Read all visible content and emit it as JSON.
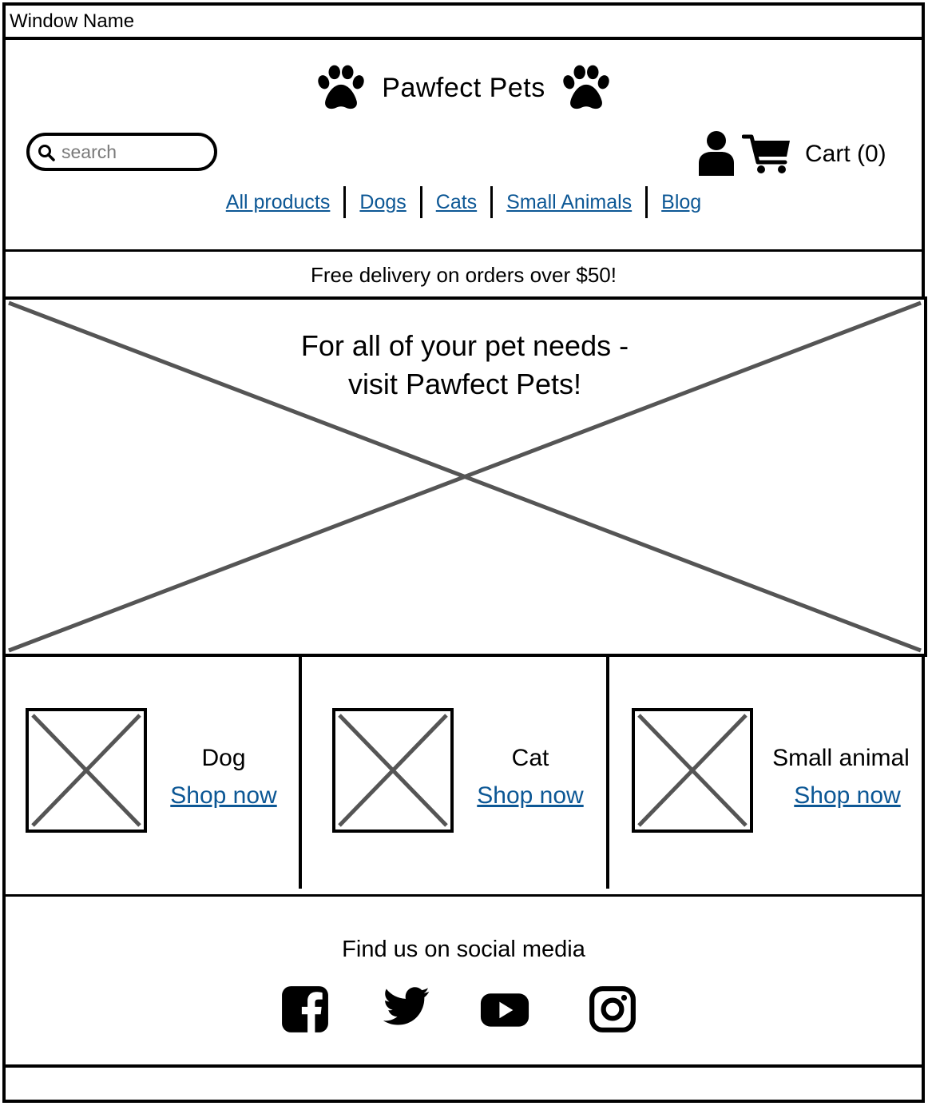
{
  "window": {
    "title": "Window Name"
  },
  "header": {
    "brand_name": "Pawfect Pets",
    "search_placeholder": "search",
    "cart_label": "Cart (0)",
    "nav": [
      "All products",
      "Dogs",
      "Cats",
      "Small Animals",
      "Blog"
    ]
  },
  "promo": {
    "text": "Free delivery on orders over $50!"
  },
  "hero": {
    "line1": "For all of your pet needs -",
    "line2": "visit Pawfect Pets!"
  },
  "categories": [
    {
      "name": "Dog",
      "link": "Shop now"
    },
    {
      "name": "Cat",
      "link": "Shop now"
    },
    {
      "name": "Small animal",
      "link": "Shop now"
    }
  ],
  "footer": {
    "social_title": "Find us on social media",
    "icons": [
      "facebook-icon",
      "twitter-icon",
      "youtube-icon",
      "instagram-icon"
    ]
  },
  "colors": {
    "link": "#0c5795",
    "placeholder_stroke": "#555555"
  }
}
